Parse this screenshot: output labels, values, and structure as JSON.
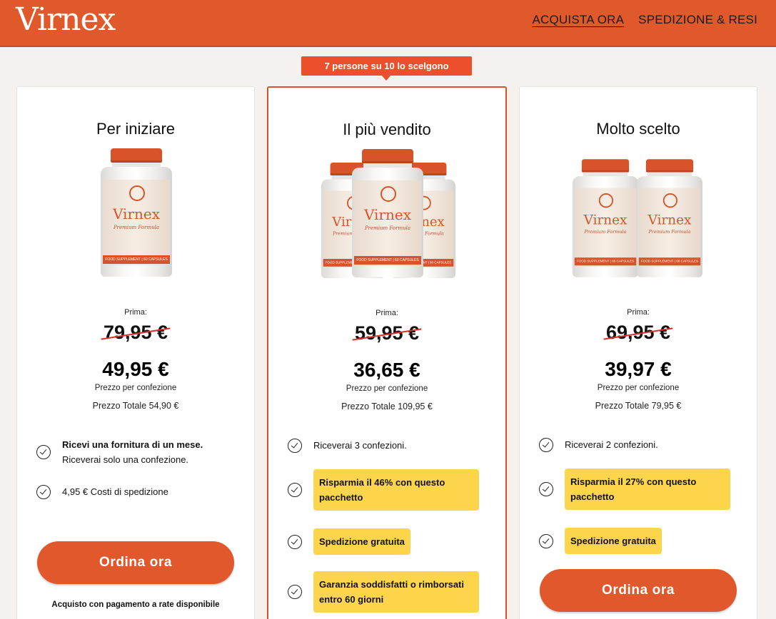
{
  "brand": {
    "name": "Virnex"
  },
  "nav": {
    "buy_now": "ACQUISTA ORA",
    "shipping": "SPEDIZIONE & RESI"
  },
  "popular_badge": "7 persone su 10 lo scelgono",
  "bottle": {
    "name": "Virnex",
    "subtitle": "Premium Formula",
    "strip": "FOOD SUPPLEMENT | 60 CAPSULES"
  },
  "plans": [
    {
      "title": "Per iniziare",
      "before_label": "Prima:",
      "old_price": "79,95 €",
      "price": "49,95 €",
      "per_pack": "Prezzo per confezione",
      "total": "Prezzo Totale 54,90 €",
      "feature_1_bold": "Ricevi una fornitura di un mese.",
      "feature_1_text": "Riceverai solo una confezione.",
      "feature_2": "4,95 € Costi di spedizione",
      "button": "Ordina ora",
      "installments": "Acquisto con pagamento a rate disponibile"
    },
    {
      "title": "Il più vendito",
      "before_label": "Prima:",
      "old_price": "59,95 €",
      "price": "36,65 €",
      "per_pack": "Prezzo per confezione",
      "total": "Prezzo Totale 109,95 €",
      "feature_1": "Riceverai 3 confezioni.",
      "feature_2": "Risparmia il 46% con questo pacchetto",
      "feature_3": "Spedizione gratuita",
      "feature_4": "Garanzia soddisfatti o rimborsati entro 60 giorni"
    },
    {
      "title": "Molto scelto",
      "before_label": "Prima:",
      "old_price": "69,95 €",
      "price": "39,97 €",
      "per_pack": "Prezzo per confezione",
      "total": "Prezzo Totale 79,95 €",
      "feature_1": "Riceverai 2 confezioni.",
      "feature_2": "Risparmia il 27% con questo pacchetto",
      "feature_3": "Spedizione gratuita",
      "button": "Ordina ora"
    }
  ],
  "colors": {
    "header": "#e0592a",
    "accent": "#e0582b",
    "highlight": "#fcd54c",
    "strike": "#d4302c"
  }
}
